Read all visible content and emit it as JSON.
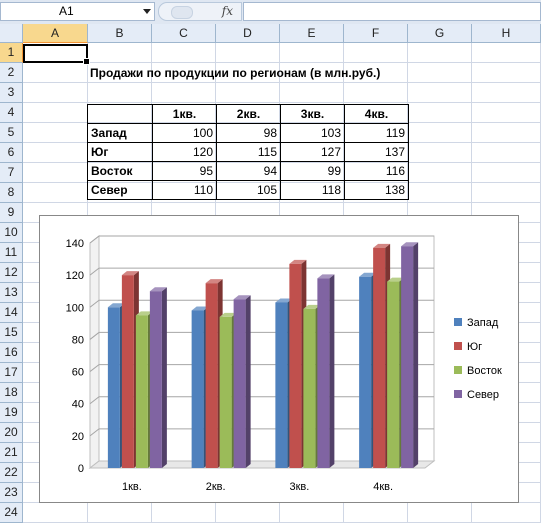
{
  "formula_bar": {
    "name_box": "A1",
    "fx_label": "fx",
    "formula": ""
  },
  "columns": [
    "A",
    "B",
    "C",
    "D",
    "E",
    "F",
    "G",
    "H"
  ],
  "rows": [
    "1",
    "2",
    "3",
    "4",
    "5",
    "6",
    "7",
    "8",
    "9",
    "10",
    "11",
    "12",
    "13",
    "14",
    "15",
    "16",
    "17",
    "18",
    "19",
    "20",
    "21",
    "22",
    "23",
    "24"
  ],
  "sheet": {
    "title": "Продажи по продукции по регионам (в млн.руб.)",
    "table": {
      "headers": [
        "",
        "1кв.",
        "2кв.",
        "3кв.",
        "4кв."
      ],
      "rows": [
        {
          "label": "Запад",
          "values": [
            "100",
            "98",
            "103",
            "119"
          ]
        },
        {
          "label": "Юг",
          "values": [
            "120",
            "115",
            "127",
            "137"
          ]
        },
        {
          "label": "Восток",
          "values": [
            "95",
            "94",
            "99",
            "116"
          ]
        },
        {
          "label": "Север",
          "values": [
            "110",
            "105",
            "118",
            "138"
          ]
        }
      ]
    }
  },
  "chart_data": {
    "type": "bar",
    "categories": [
      "1кв.",
      "2кв.",
      "3кв.",
      "4кв."
    ],
    "series": [
      {
        "name": "Запад",
        "color": "#4f81bd",
        "values": [
          100,
          98,
          103,
          119
        ]
      },
      {
        "name": "Юг",
        "color": "#c0504d",
        "values": [
          120,
          115,
          127,
          137
        ]
      },
      {
        "name": "Восток",
        "color": "#9bbb59",
        "values": [
          95,
          94,
          99,
          116
        ]
      },
      {
        "name": "Север",
        "color": "#8064a2",
        "values": [
          110,
          105,
          118,
          138
        ]
      }
    ],
    "yticks": [
      "0",
      "20",
      "40",
      "60",
      "80",
      "100",
      "120",
      "140"
    ],
    "ylim": [
      0,
      140
    ],
    "grid": true,
    "legend": "right",
    "style": "3d-clustered-column"
  }
}
